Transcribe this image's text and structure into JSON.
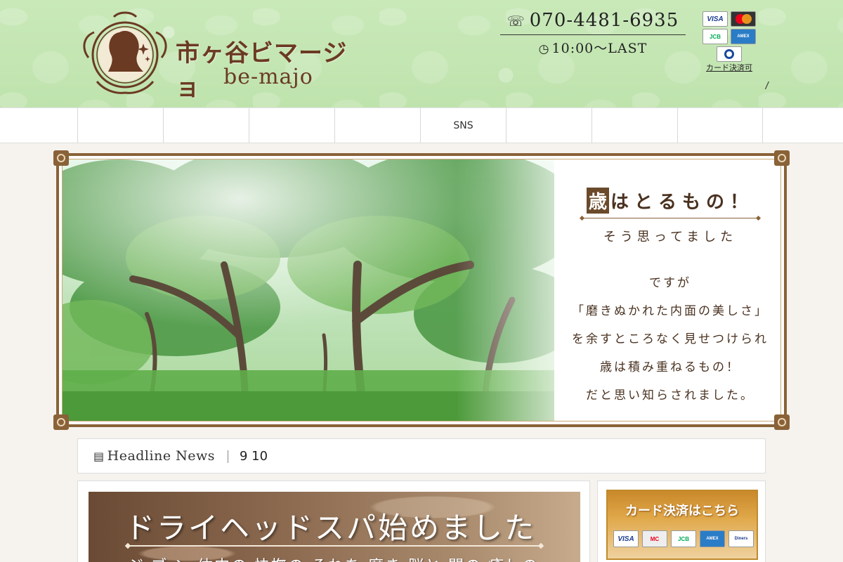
{
  "header": {
    "logo_jp": "市ヶ谷ビマージョ",
    "logo_en": "be-majo",
    "phone": "070-4481-6935",
    "phone_sub": "",
    "hours": "10:00～LAST",
    "card_note": "カード決済可",
    "address_line1": "",
    "address_line2": "/"
  },
  "cards": {
    "visa": "VISA",
    "master": "MasterCard",
    "jcb": "JCB",
    "amex": "AMERICAN EXPRESS",
    "diners": "Diners Club"
  },
  "nav": {
    "items": [
      {
        "label": ""
      },
      {
        "label": ""
      },
      {
        "label": ""
      },
      {
        "label": ""
      },
      {
        "label": "SNS"
      },
      {
        "label": ""
      },
      {
        "label": ""
      },
      {
        "label": ""
      }
    ]
  },
  "hero": {
    "title_box": "歳",
    "title_rest": "はとるもの！",
    "subtitle": "そう思ってました",
    "lines": [
      "ですが",
      "「磨きぬかれた内面の美しさ」",
      "を余すところなく見せつけられ",
      "歳は積み重ねるもの！",
      "だと思い知らされました。"
    ]
  },
  "news": {
    "label": "Headline News",
    "text": "9 10"
  },
  "main": {
    "spa_title": "ドライヘッドスパ始めました",
    "spa_sub": "ジ ブ ン 体内の 快撫の それを 磨き 脳と 間の 癒しの"
  },
  "side": {
    "card_banner_title": "カード決済はこちら",
    "mini_cards": [
      "VISA",
      "MasterCard",
      "JCB",
      "AMEX",
      "Diners Club"
    ]
  },
  "colors": {
    "header_green": "#c5e7b4",
    "brand_brown": "#6b3a22",
    "frame_brown": "#8a6238"
  }
}
